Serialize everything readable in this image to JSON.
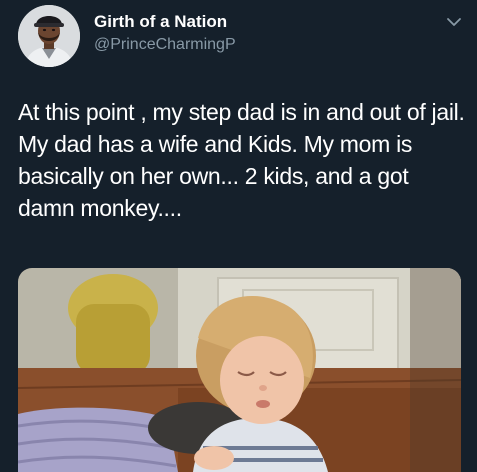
{
  "tweet": {
    "display_name": "Girth of a Nation",
    "handle": "@PrinceCharmingP",
    "text": "At this point , my step dad is in and out of jail. My dad has a wife and Kids. My mom is basically on her own... 2 kids, and a got damn monkey....",
    "menu_icon": "chevron-down-icon",
    "avatar_icon": "profile-avatar",
    "media_description_icon": "attached-photo"
  },
  "colors": {
    "background": "#15202b",
    "text": "#ffffff",
    "secondary_text": "#8899a6"
  }
}
